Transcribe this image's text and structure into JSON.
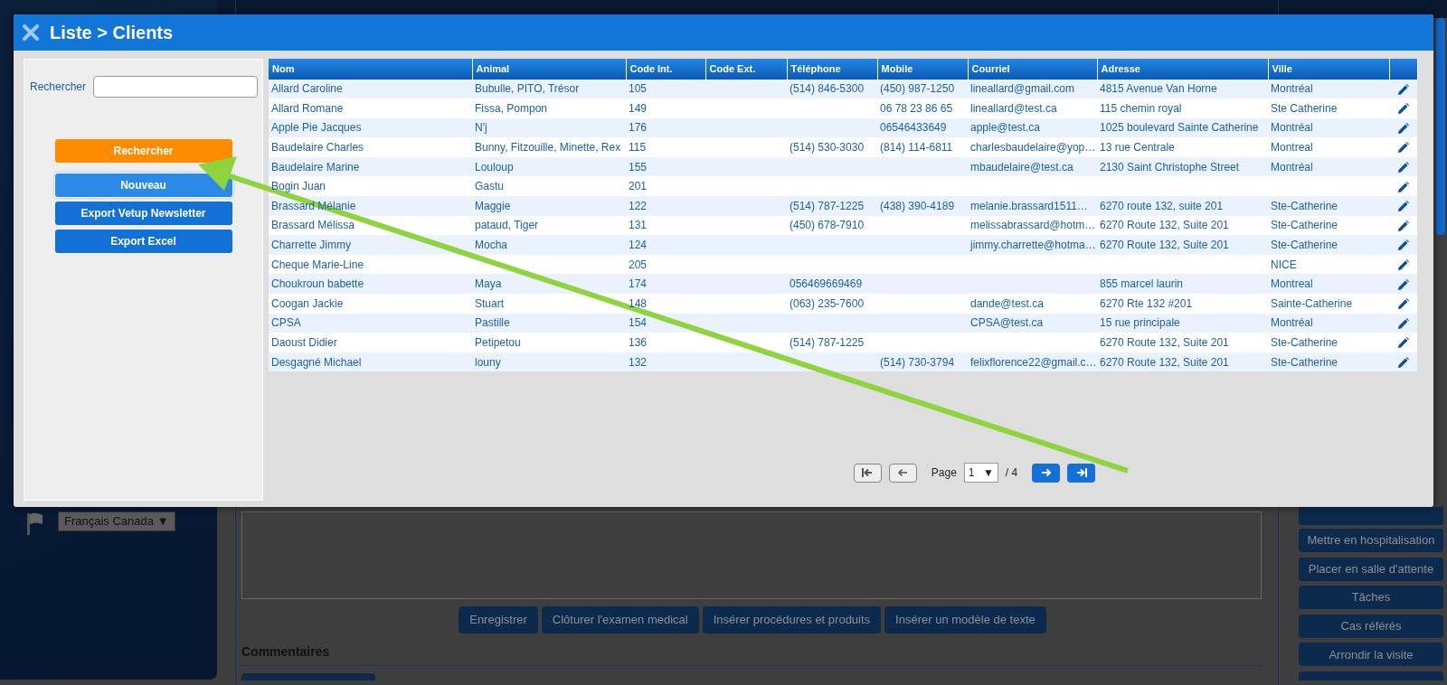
{
  "background": {
    "language": "Français Canada",
    "language_caret": "▼",
    "form_buttons": [
      "Enregistrer",
      "Clôturer l'examen medical",
      "Insérer procédures et produits",
      "Insérer un modèle de texte"
    ],
    "comments_heading": "Commentaires",
    "side_buttons": [
      "Mettre en hospitalisation",
      "Placer en salle d'attente",
      "Tâches",
      "Cas référés",
      "Arrondir la visite"
    ]
  },
  "modal": {
    "title": "Liste > Clients",
    "search": {
      "label": "Rechercher"
    },
    "buttons": [
      {
        "label": "Rechercher",
        "kind": "search"
      },
      {
        "label": "Nouveau",
        "kind": "focused"
      },
      {
        "label": "Export Vetup Newsletter",
        "kind": "normal"
      },
      {
        "label": "Export Excel",
        "kind": "normal"
      }
    ],
    "table": {
      "columns": [
        "Nom",
        "Animal",
        "Code Int.",
        "Code Ext.",
        "Téléphone",
        "Mobile",
        "Courriel",
        "Adresse",
        "Ville"
      ],
      "rows": [
        {
          "nom": "Allard Caroline",
          "animal": "Bubulle, PITO, Trésor",
          "code_int": "105",
          "telephone": "(514) 846-5300",
          "mobile": "(450) 987-1250",
          "courriel": "lineallard@gmail.com",
          "adresse": "4815 Avenue Van Horne",
          "ville": "Montréal"
        },
        {
          "nom": "Allard Romane",
          "animal": "Fissa, Pompon",
          "code_int": "149",
          "mobile": "06 78 23 86 65",
          "courriel": "lineallard@test.ca",
          "adresse": "115 chemin royal",
          "ville": "Ste Catherine"
        },
        {
          "nom": "Apple Pie Jacques",
          "animal": "N'j",
          "code_int": "176",
          "mobile": "06546433649",
          "courriel": "apple@test.ca",
          "adresse": "1025 boulevard Sainte Catherine",
          "ville": "Montréal"
        },
        {
          "nom": "Baudelaire Charles",
          "animal": "Bunny, Fitzouille, Minette, Rex",
          "code_int": "115",
          "telephone": "(514) 530-3030",
          "mobile": "(814) 114-6811",
          "courriel": "charlesbaudelaire@yop…",
          "adresse": "13 rue Centrale",
          "ville": "Montreal"
        },
        {
          "nom": "Baudelaire Marine",
          "animal": "Louloup",
          "code_int": "155",
          "courriel": "mbaudelaire@test.ca",
          "adresse": "2130 Saint Christophe Street",
          "ville": "Montréal"
        },
        {
          "nom": "Bogin Juan",
          "animal": "Gastu",
          "code_int": "201"
        },
        {
          "nom": "Brassard Mélanie",
          "animal": "Maggie",
          "code_int": "122",
          "telephone": "(514) 787-1225",
          "mobile": "(438) 390-4189",
          "courriel": "melanie.brassard1511…",
          "adresse": "6270 route 132, suite 201",
          "ville": "Ste-Catherine"
        },
        {
          "nom": "Brassard Mélissa",
          "animal": "pataud, Tiger",
          "code_int": "131",
          "telephone": "(450) 678-7910",
          "courriel": "melissabrassard@hotm…",
          "adresse": "6270 Route 132, Suite 201",
          "ville": "Ste-Catherine"
        },
        {
          "nom": "Charrette Jimmy",
          "animal": "Mocha",
          "code_int": "124",
          "courriel": "jimmy.charrette@hotma…",
          "adresse": "6270 Route 132, Suite 201",
          "ville": "Ste-Catherine"
        },
        {
          "nom": "Cheque Marie-Line",
          "code_int": "205",
          "ville": "NICE"
        },
        {
          "nom": "Choukroun babette",
          "animal": "Maya",
          "code_int": "174",
          "telephone": "056469669469",
          "adresse": "855 marcel laurin",
          "ville": "Montreal"
        },
        {
          "nom": "Coogan Jackie",
          "animal": "Stuart",
          "code_int": "148",
          "telephone": "(063) 235-7600",
          "courriel": "dande@test.ca",
          "adresse": "6270 Rte 132 #201",
          "ville": "Sainte-Catherine"
        },
        {
          "nom": "CPSA",
          "animal": "Pastille",
          "code_int": "154",
          "courriel": "CPSA@test.ca",
          "adresse": "15 rue principale",
          "ville": "Montréal"
        },
        {
          "nom": "Daoust Didier",
          "animal": "Petipetou",
          "code_int": "136",
          "telephone": "(514) 787-1225",
          "adresse": "6270 Route 132, Suite 201",
          "ville": "Ste-Catherine"
        },
        {
          "nom": "Desgagné Michael",
          "animal": "louny",
          "code_int": "132",
          "mobile": "(514) 730-3794",
          "courriel": "felixflorence22@gmail.c…",
          "adresse": "6270 Route 132, Suite 201",
          "ville": "Ste-Catherine"
        }
      ]
    },
    "pagination": {
      "label": "Page",
      "current": "1",
      "caret": "▼",
      "total": "/ 4"
    }
  },
  "annotation": {
    "kind": "arrow"
  }
}
